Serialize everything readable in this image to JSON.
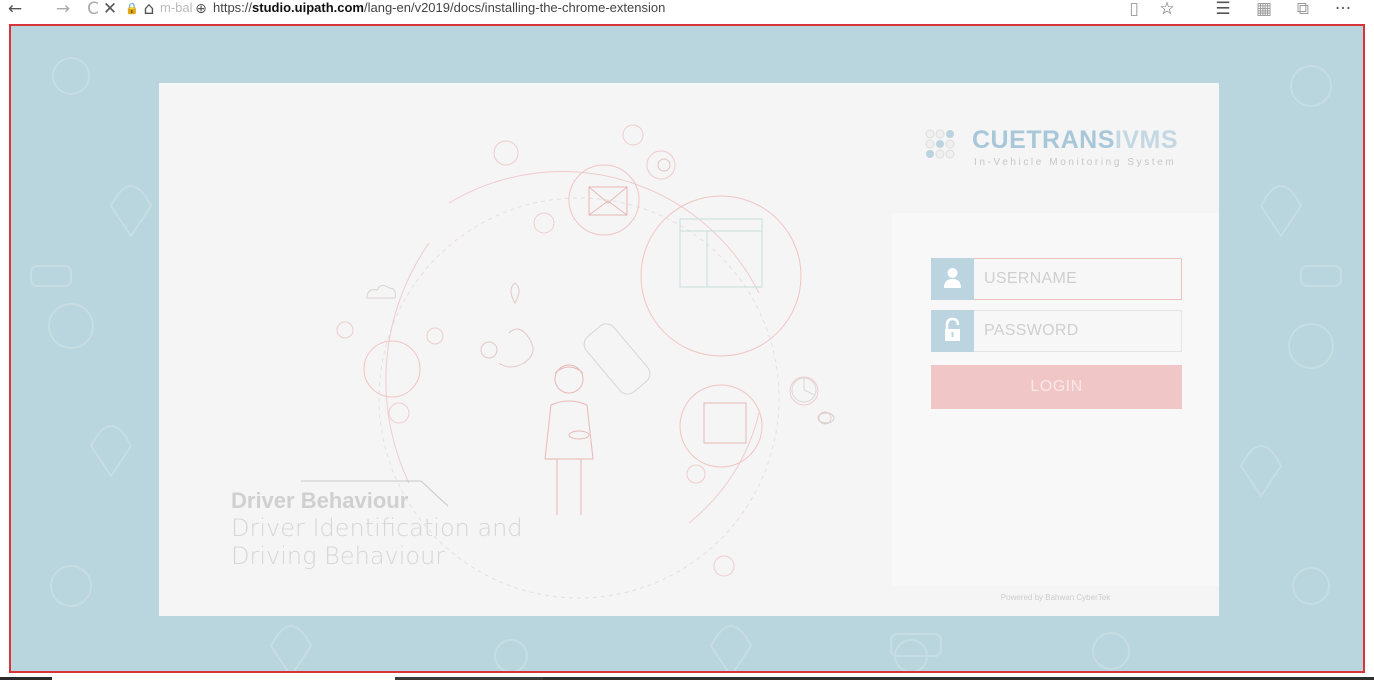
{
  "browser": {
    "url_prefix": "https://",
    "url_host": "studio.uipath.com",
    "url_path": "/lang-en/v2019/docs/installing-the-chrome-extension",
    "ghost_text": "m-bal",
    "icons": {
      "back": "←",
      "forward": "→",
      "refresh": "C",
      "close": "✕",
      "lock": "🔒",
      "home": "⌂",
      "globe": "⊕",
      "reading": "▯",
      "favorite": "☆",
      "favorites_list": "☰",
      "collections": "▦",
      "share": "⧉",
      "more": "···"
    }
  },
  "brand": {
    "name_part1": "CUETRANS",
    "name_part2": "IVMS",
    "subtitle": "In-Vehicle Monitoring System"
  },
  "hero": {
    "title": "Driver Behaviour",
    "line1": "Driver Identification and",
    "line2": "Driving Behaviour"
  },
  "login": {
    "username_placeholder": "USERNAME",
    "password_placeholder": "PASSWORD",
    "button_label": "LOGIN"
  },
  "footer": {
    "powered_by": "Powered by Bahwan CyberTek"
  },
  "colors": {
    "page_bg": "#b9d5dd",
    "frame_border": "#d9333a",
    "card_bg": "#f5f5f5",
    "login_button": "#f0c6c7",
    "icon_bg": "#bcd3e0"
  }
}
